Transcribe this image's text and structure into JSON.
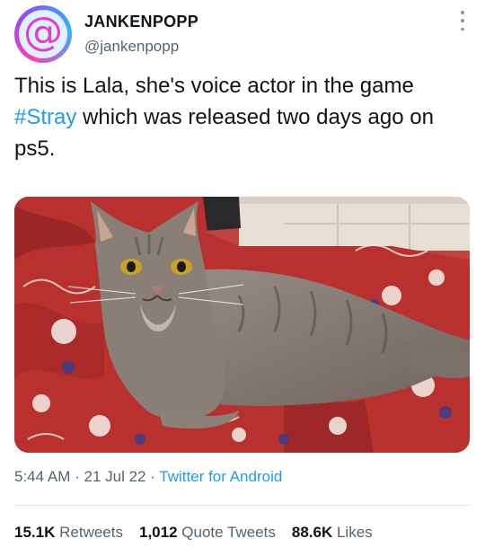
{
  "author": {
    "display_name": "JANKENPOPP",
    "handle": "@jankenpopp",
    "avatar_icon": "at-sign-icon",
    "avatar_glyph": "@"
  },
  "tweet": {
    "text_before": "This is Lala, she's voice actor in the game ",
    "hashtag": "#Stray",
    "text_after": " which was released two days ago on ps5.",
    "media": {
      "icon": "cat-photo"
    }
  },
  "meta": {
    "time": "5:44 AM",
    "separator1": " · ",
    "date": "21 Jul 22",
    "separator2": " · ",
    "source": "Twitter for Android"
  },
  "stats": {
    "retweets_count": "15.1K",
    "retweets_label": "Retweets",
    "quotes_count": "1,012",
    "quotes_label": "Quote Tweets",
    "likes_count": "88.6K",
    "likes_label": "Likes"
  },
  "colors": {
    "link": "#1d9bf0",
    "secondary_text": "#536471",
    "primary_text": "#0f1419"
  }
}
